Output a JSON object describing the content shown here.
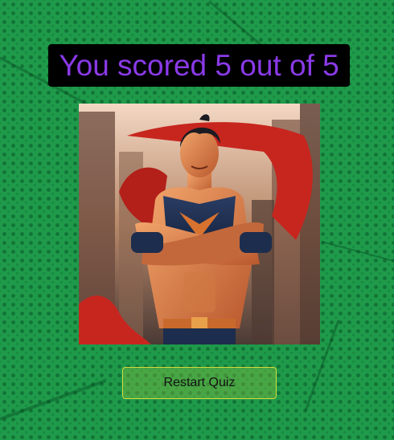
{
  "result": {
    "score_text": "You scored 5 out of 5",
    "score": 5,
    "total": 5
  },
  "image": {
    "subject": "superhero-illustration"
  },
  "actions": {
    "restart_label": "Restart Quiz"
  },
  "colors": {
    "background": "#1f9a4a",
    "score_text": "#8a3ae8",
    "banner": "#000000",
    "button_border": "#d7dc3a"
  }
}
